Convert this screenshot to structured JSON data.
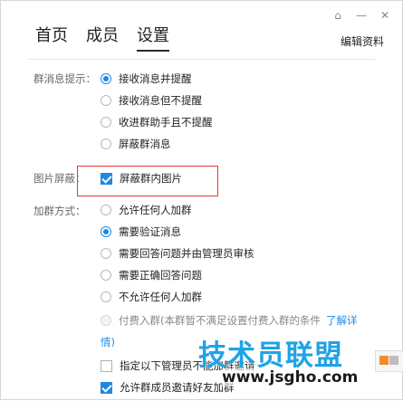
{
  "window_buttons": [
    {
      "icon": "pin-icon",
      "glyph": "⌂"
    },
    {
      "icon": "minimize-icon",
      "glyph": "—"
    },
    {
      "icon": "close-icon",
      "glyph": "✕"
    }
  ],
  "tabs": [
    {
      "label": "首页"
    },
    {
      "label": "成员"
    },
    {
      "label": "设置",
      "active": true
    }
  ],
  "edit_profile": "编辑资料",
  "group_notify": {
    "label": "群消息提示：",
    "options": [
      {
        "text": "接收消息并提醒",
        "selected": true
      },
      {
        "text": "接收消息但不提醒",
        "selected": false
      },
      {
        "text": "收进群助手且不提醒",
        "selected": false
      },
      {
        "text": "屏蔽群消息",
        "selected": false
      }
    ]
  },
  "image_block": {
    "label": "图片屏蔽：",
    "option": {
      "text": "屏蔽群内图片",
      "checked": true
    }
  },
  "join_method": {
    "label": "加群方式：",
    "options": [
      {
        "text": "允许任何人加群",
        "selected": false
      },
      {
        "text": "需要验证消息",
        "selected": true
      },
      {
        "text": "需要回答问题并由管理员审核",
        "selected": false
      },
      {
        "text": "需要正确回答问题",
        "selected": false
      },
      {
        "text": "不允许任何人加群",
        "selected": false
      }
    ],
    "paid_option": {
      "text": "付费入群(本群暂不满足设置付费入群的条件",
      "link_part1": "了解详",
      "link_part2": "情)"
    }
  },
  "admin_check": {
    "text": "指定以下管理员不能加群邀请",
    "checked": false
  },
  "member_invite": {
    "text": "允许群成员邀请好友加群",
    "checked": true
  },
  "watermark": {
    "main": "技术员联盟",
    "url": "www.jsgho.com"
  },
  "colors": {
    "accent": "#1e88e5",
    "highlight": "#e53935",
    "watermark": "#1fa3e6"
  }
}
